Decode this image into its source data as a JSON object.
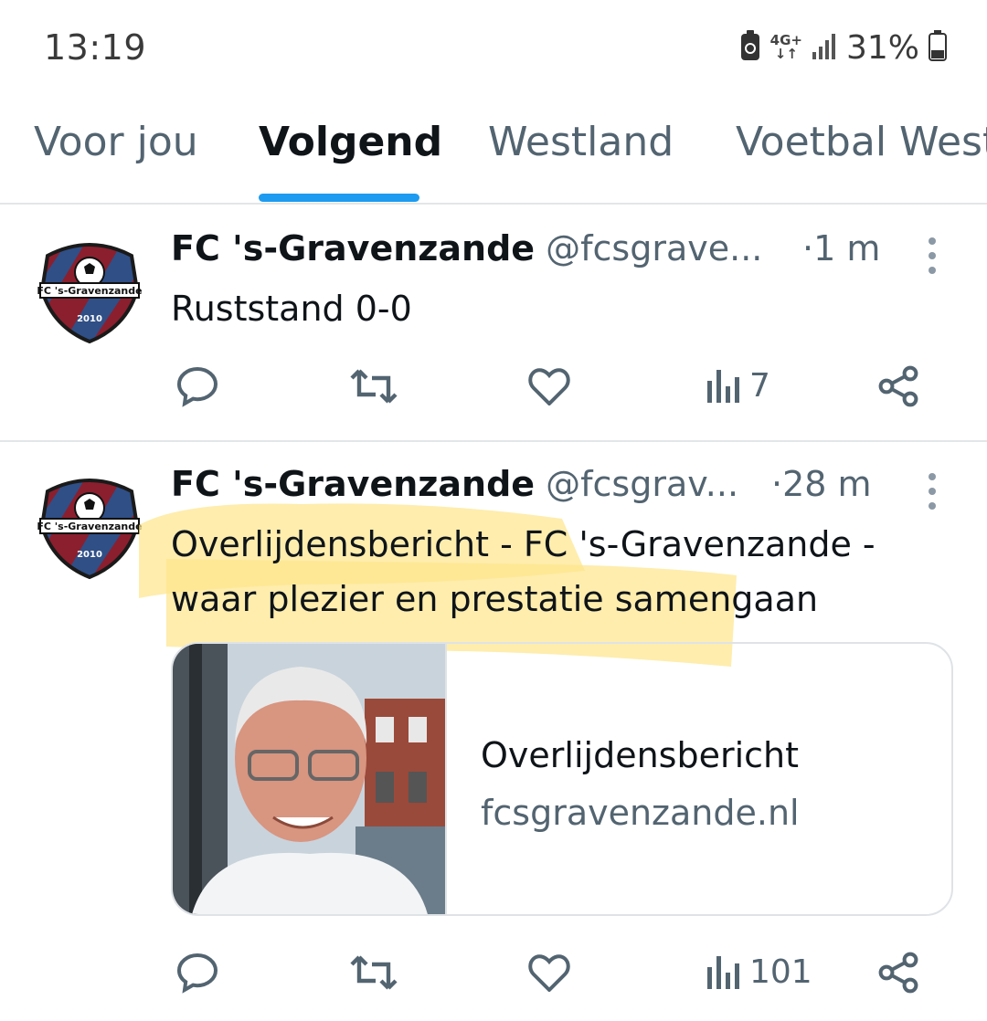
{
  "status_bar": {
    "time": "13:19",
    "network_top": "4G+",
    "network_bottom": "↓↑",
    "battery": "31%"
  },
  "tabs": [
    {
      "label": "Voor jou",
      "active": false
    },
    {
      "label": "Volgend",
      "active": true
    },
    {
      "label": "Westland",
      "active": false
    },
    {
      "label": "Voetbal West",
      "active": false
    }
  ],
  "colors": {
    "accent": "#1d9bf0",
    "secondary_text": "#536471",
    "highlight": "#fde68a"
  },
  "tweets": [
    {
      "author": "FC 's-Gravenzande",
      "handle": "@fcsgrave...",
      "dot": "·",
      "time": "1 m",
      "text": "Ruststand 0-0",
      "views": "7",
      "avatar_text": "FC 's-Gravenzande",
      "avatar_year": "2010"
    },
    {
      "author": "FC 's-Gravenzande",
      "handle": "@fcsgrav...",
      "dot": "·",
      "time": "28 m",
      "text_line1": "Overlijdensbericht - FC 's-Gravenzande -",
      "text_line2": "waar plezier en prestatie samengaan",
      "views": "101",
      "avatar_text": "FC 's-Gravenzande",
      "avatar_year": "2010",
      "card": {
        "title": "Overlijdensbericht",
        "domain": "fcsgravenzande.nl"
      }
    }
  ],
  "icons": [
    "battery-saver-icon",
    "signal-icon",
    "battery-icon",
    "reply-icon",
    "retweet-icon",
    "like-icon",
    "views-icon",
    "share-icon",
    "more-icon"
  ]
}
